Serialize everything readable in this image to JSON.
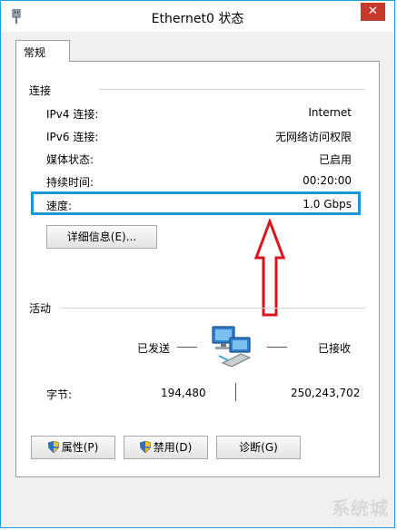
{
  "window": {
    "title": "Ethernet0 状态",
    "close_label": "✕"
  },
  "tabs": [
    {
      "label": "常规",
      "selected": true
    }
  ],
  "connection": {
    "section_label": "连接",
    "rows": [
      {
        "label": "IPv4 连接:",
        "value": "Internet"
      },
      {
        "label": "IPv6 连接:",
        "value": "无网络访问权限"
      },
      {
        "label": "媒体状态:",
        "value": "已启用"
      },
      {
        "label": "持续时间:",
        "value": "00:20:00"
      },
      {
        "label": "速度:",
        "value": "1.0 Gbps"
      }
    ],
    "details_button": "详细信息(E)..."
  },
  "activity": {
    "section_label": "活动",
    "sent_label": "已发送",
    "received_label": "已接收",
    "bytes_label": "字节:",
    "bytes_sent": "194,480",
    "bytes_received": "250,243,702"
  },
  "buttons": {
    "properties": "属性(P)",
    "disable": "禁用(D)",
    "diagnose": "诊断(G)"
  },
  "watermark": "系统城",
  "colors": {
    "window_border": "#1e9de0",
    "highlight_box": "#1b97d8",
    "annotation_arrow": "#d8141c",
    "close_button": "#c7392b"
  },
  "icons": {
    "app": "network-adapter-icon",
    "activity": "network-computers-icon",
    "uac": "uac-shield-icon"
  }
}
